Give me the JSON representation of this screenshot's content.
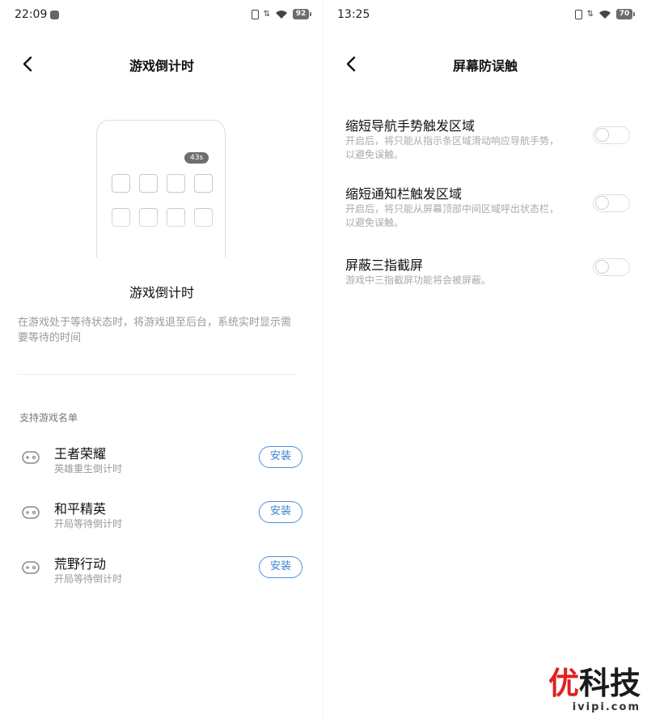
{
  "left_screen": {
    "status": {
      "time": "22:09",
      "battery": "92"
    },
    "header": {
      "title": "游戏倒计时"
    },
    "illustration": {
      "timer_badge": "43s"
    },
    "feature": {
      "title": "游戏倒计时",
      "description": "在游戏处于等待状态时，将游戏退至后台，系统实时显示需要等待的时间"
    },
    "section_heading": "支持游戏名单",
    "games": [
      {
        "name": "王者荣耀",
        "subtitle": "英雄重生倒计时",
        "button": "安装"
      },
      {
        "name": "和平精英",
        "subtitle": "开局等待倒计时",
        "button": "安装"
      },
      {
        "name": "荒野行动",
        "subtitle": "开局等待倒计时",
        "button": "安装"
      }
    ]
  },
  "right_screen": {
    "status": {
      "time": "13:25",
      "battery": "70"
    },
    "header": {
      "title": "屏幕防误触"
    },
    "settings": [
      {
        "title": "缩短导航手势触发区域",
        "description": "开启后，将只能从指示条区域滑动响应导航手势，以避免误触。",
        "enabled": false
      },
      {
        "title": "缩短通知栏触发区域",
        "description": "开启后，将只能从屏幕顶部中间区域呼出状态栏，以避免误触。",
        "enabled": false
      },
      {
        "title": "屏蔽三指截屏",
        "description": "游戏中三指截屏功能将会被屏蔽。",
        "enabled": false
      }
    ]
  },
  "watermark": {
    "logo": "优科技",
    "url": "ivipi.com"
  },
  "colors": {
    "accent": "#3c83d4",
    "watermark_red": "#e02020"
  }
}
